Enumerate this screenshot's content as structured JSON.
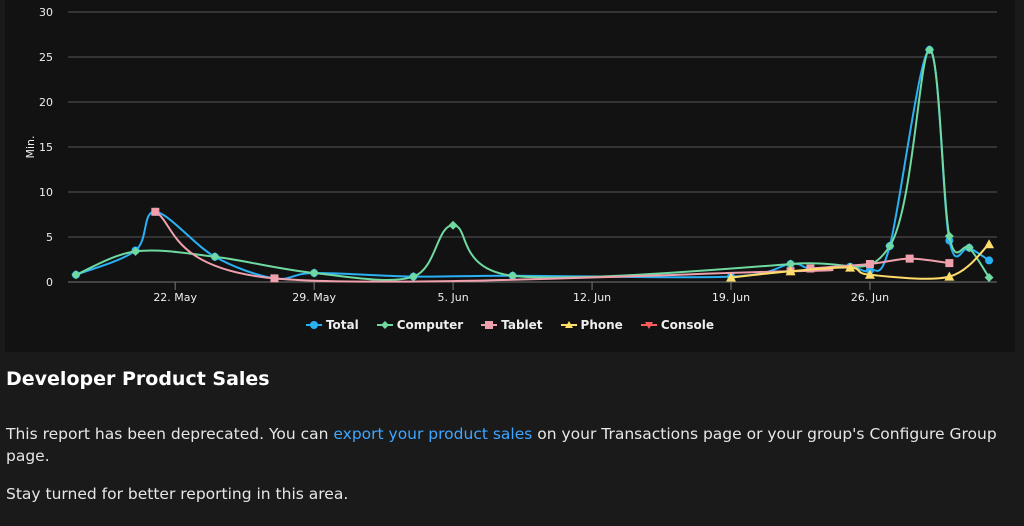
{
  "chart_data": {
    "type": "line",
    "ylabel": "Min.",
    "ylim": [
      0,
      30
    ],
    "yticks": [
      "0",
      "5",
      "10",
      "15",
      "20",
      "25",
      "30"
    ],
    "xticks": [
      "22. May",
      "29. May",
      "5. Jun",
      "12. Jun",
      "19. Jun",
      "26. Jun"
    ],
    "xtick_days": [
      0,
      7,
      14,
      21,
      28,
      35
    ],
    "xlim_days": [
      -5.4,
      41.4
    ],
    "x_unit": "days since 22 May",
    "grid": true,
    "legend_position": "bottom",
    "series": [
      {
        "name": "Total",
        "color": "#2ab0f5",
        "marker": "circle",
        "points": [
          [
            -5,
            0.8
          ],
          [
            -2,
            3.5
          ],
          [
            -1,
            7.8
          ],
          [
            2,
            2.8
          ],
          [
            5,
            0.4
          ],
          [
            7,
            1.0
          ],
          [
            12,
            0.6
          ],
          [
            17,
            0.7
          ],
          [
            28,
            0.6
          ],
          [
            31,
            2.0
          ],
          [
            32,
            1.5
          ],
          [
            34,
            1.7
          ],
          [
            35,
            1.3
          ],
          [
            36,
            4.0
          ],
          [
            38,
            25.8
          ],
          [
            39,
            4.6
          ],
          [
            40,
            3.8
          ],
          [
            41,
            2.4
          ]
        ]
      },
      {
        "name": "Computer",
        "color": "#6fd9a0",
        "marker": "diamond",
        "points": [
          [
            -5,
            0.8
          ],
          [
            -2,
            3.4
          ],
          [
            2,
            2.8
          ],
          [
            7,
            1.0
          ],
          [
            12,
            0.6
          ],
          [
            14,
            6.3
          ],
          [
            17,
            0.7
          ],
          [
            31,
            2.0
          ],
          [
            36,
            4.0
          ],
          [
            38,
            25.8
          ],
          [
            39,
            5.1
          ],
          [
            40,
            3.8
          ],
          [
            41,
            0.5
          ]
        ]
      },
      {
        "name": "Tablet",
        "color": "#f0a0ad",
        "marker": "square",
        "points": [
          [
            -1,
            7.8
          ],
          [
            5,
            0.4
          ],
          [
            31,
            1.2
          ],
          [
            32,
            1.5
          ],
          [
            35,
            2.0
          ],
          [
            37,
            2.6
          ],
          [
            39,
            2.1
          ]
        ]
      },
      {
        "name": "Phone",
        "color": "#ffdd6a",
        "marker": "triangle",
        "points": [
          [
            28,
            0.5
          ],
          [
            31,
            1.2
          ],
          [
            34,
            1.6
          ],
          [
            35,
            0.8
          ],
          [
            39,
            0.6
          ],
          [
            41,
            4.2
          ]
        ]
      },
      {
        "name": "Console",
        "color": "#ff5a5a",
        "marker": "triangle-down",
        "points": []
      }
    ]
  },
  "report": {
    "title": "Developer Product Sales",
    "p1_before": "This report has been deprecated. You can ",
    "p1_link": "export your product sales",
    "p1_after": " on your Transactions page or your group's Configure Group page.",
    "p2": "Stay turned for better reporting in this area."
  }
}
